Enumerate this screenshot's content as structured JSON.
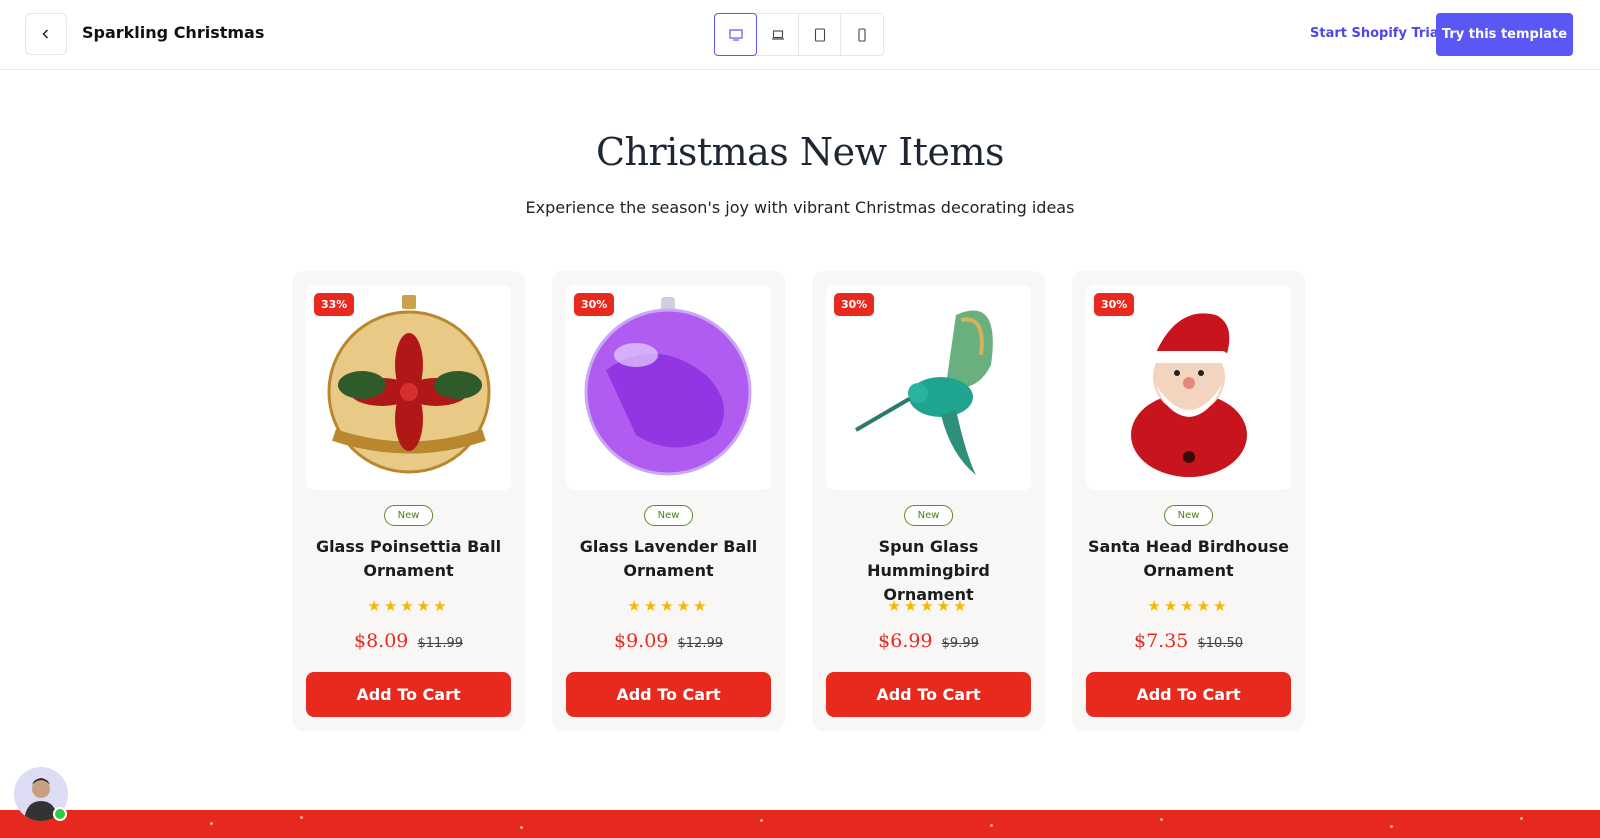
{
  "topbar": {
    "store_title": "Sparkling Christmas",
    "devices": [
      "desktop",
      "laptop",
      "tablet",
      "mobile"
    ],
    "active_device": "desktop",
    "trial_link": "Start Shopify Trial",
    "try_button": "Try this template"
  },
  "section": {
    "title": "Christmas New Items",
    "subtitle": "Experience the season's joy with vibrant Christmas decorating ideas"
  },
  "products": [
    {
      "badge": "33%",
      "tag": "New",
      "name": "Glass Poinsettia Ball Ornament",
      "stars": "★★★★★",
      "price": "$8.09",
      "old_price": "$11.99",
      "cart": "Add To Cart"
    },
    {
      "badge": "30%",
      "tag": "New",
      "name": "Glass Lavender Ball Ornament",
      "stars": "★★★★★",
      "price": "$9.09",
      "old_price": "$12.99",
      "cart": "Add To Cart"
    },
    {
      "badge": "30%",
      "tag": "New",
      "name": "Spun Glass Hummingbird Ornament",
      "stars": "★★★★★",
      "price": "$6.99",
      "old_price": "$9.99",
      "cart": "Add To Cart"
    },
    {
      "badge": "30%",
      "tag": "New",
      "name": "Santa Head Birdhouse Ornament",
      "stars": "★★★★★",
      "price": "$7.35",
      "old_price": "$10.50",
      "cart": "Add To Cart"
    }
  ],
  "colors": {
    "accent": "#5b57f5",
    "sale_red": "#e8291d",
    "new_tag_green": "#4f7d1f",
    "star_gold": "#f5b800"
  }
}
